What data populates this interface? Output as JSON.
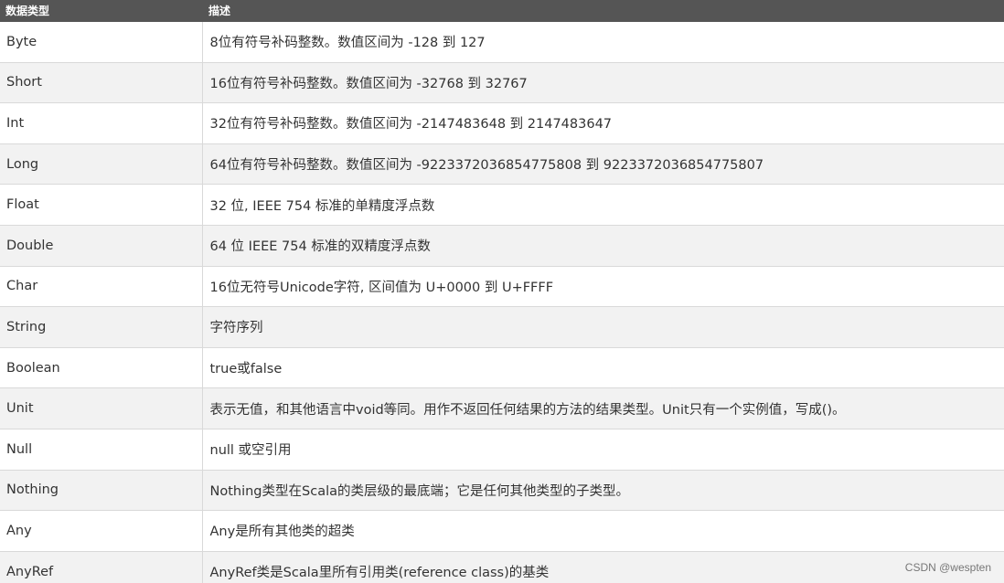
{
  "table": {
    "headers": [
      "数据类型",
      "描述"
    ],
    "rows": [
      {
        "type": "Byte",
        "desc": "8位有符号补码整数。数值区间为 -128 到 127"
      },
      {
        "type": "Short",
        "desc": "16位有符号补码整数。数值区间为 -32768 到 32767"
      },
      {
        "type": "Int",
        "desc": "32位有符号补码整数。数值区间为 -2147483648 到 2147483647"
      },
      {
        "type": "Long",
        "desc": "64位有符号补码整数。数值区间为 -9223372036854775808 到 9223372036854775807"
      },
      {
        "type": "Float",
        "desc": "32 位, IEEE 754 标准的单精度浮点数"
      },
      {
        "type": "Double",
        "desc": "64 位 IEEE 754 标准的双精度浮点数"
      },
      {
        "type": "Char",
        "desc": "16位无符号Unicode字符, 区间值为 U+0000 到 U+FFFF"
      },
      {
        "type": "String",
        "desc": "字符序列"
      },
      {
        "type": "Boolean",
        "desc": "true或false"
      },
      {
        "type": "Unit",
        "desc": "表示无值，和其他语言中void等同。用作不返回任何结果的方法的结果类型。Unit只有一个实例值，写成()。"
      },
      {
        "type": "Null",
        "desc": "null 或空引用"
      },
      {
        "type": "Nothing",
        "desc": "Nothing类型在Scala的类层级的最底端；它是任何其他类型的子类型。"
      },
      {
        "type": "Any",
        "desc": "Any是所有其他类的超类"
      },
      {
        "type": "AnyRef",
        "desc": "AnyRef类是Scala里所有引用类(reference class)的基类"
      }
    ]
  },
  "watermark": "CSDN @wespten"
}
